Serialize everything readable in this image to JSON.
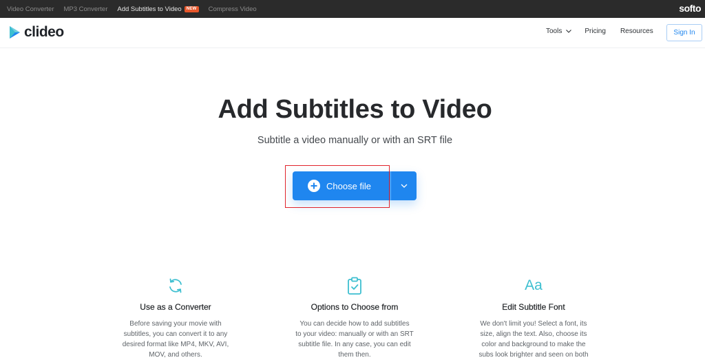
{
  "topbar": {
    "links": [
      {
        "label": "Video Converter",
        "active": false
      },
      {
        "label": "MP3 Converter",
        "active": false
      },
      {
        "label": "Add Subtitles to Video",
        "active": true,
        "badge": "NEW"
      },
      {
        "label": "Compress Video",
        "active": false
      }
    ],
    "brand": "softo"
  },
  "header": {
    "logo_text": "clideo",
    "nav": {
      "tools": "Tools",
      "pricing": "Pricing",
      "resources": "Resources"
    },
    "sign_in": "Sign In"
  },
  "hero": {
    "title": "Add Subtitles to Video",
    "subtitle": "Subtitle a video manually or with an SRT file",
    "choose_file": "Choose file"
  },
  "features": [
    {
      "icon": "refresh-icon",
      "title": "Use as a Converter",
      "lines": [
        "Before saving your movie with",
        "subtitles, you can convert it to any",
        "desired format like MP4, MKV, AVI,",
        "MOV, and others."
      ]
    },
    {
      "icon": "clipboard-check-icon",
      "title": "Options to Choose from",
      "lines": [
        "You can decide how to add subtitles",
        "to your video: manually or with an SRT",
        "subtitle file. In any case, you can edit",
        "them then."
      ]
    },
    {
      "icon": "font-icon",
      "icon_text": "Aa",
      "title": "Edit Subtitle Font",
      "lines": [
        "We don't limit you! Select a font, its",
        "size, align the text. Also, choose its",
        "color and background to make the",
        "subs look brighter and seen on both"
      ]
    }
  ],
  "colors": {
    "accent": "#1f86ef",
    "topbar_bg": "#2b2b2b",
    "feature_icon": "#3dbfd0",
    "highlight": "#e0232b",
    "badge": "#e8572b"
  }
}
